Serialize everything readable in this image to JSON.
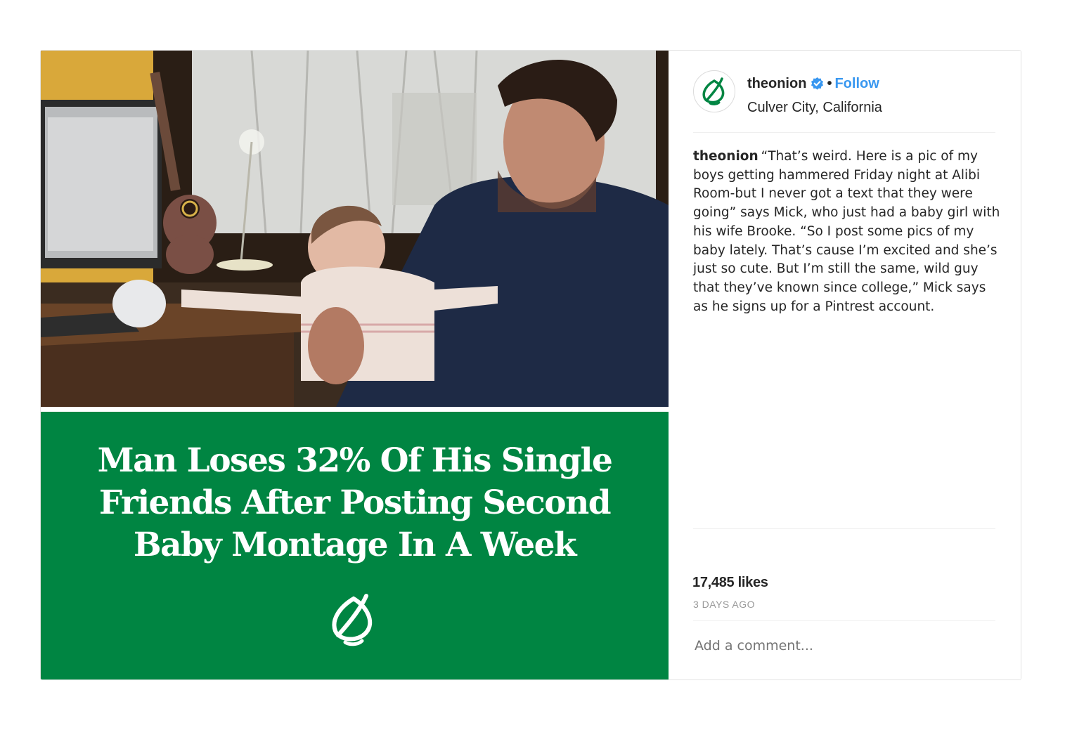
{
  "post": {
    "photo_alt": "",
    "headline": "Man Loses 32% Of His Single Friends After Posting Second Baby Montage In A Week",
    "headline_lines": [
      "Man Loses 32% Of His Single",
      "Friends After Posting Second",
      "Baby Montage In A Week"
    ]
  },
  "header": {
    "username": "theonion",
    "verified_icon": "verified-badge-icon",
    "separator": "•",
    "follow_label": "Follow",
    "location": "Culver City, California"
  },
  "caption": {
    "username": "theonion",
    "text": "“That’s weird. Here is a pic of my boys getting hammered Friday night at Alibi Room-but I never got a text that they were going” says Mick, who just had a baby girl with his wife Brooke. “So I post some pics of my baby lately. That’s cause I’m excited and she’s just so cute. But I’m still the same, wild guy that they’ve known since college,” Mick says as he signs up for a Pintrest account."
  },
  "stats": {
    "likes": "17,485 likes",
    "time_ago": "3 DAYS AGO"
  },
  "comment": {
    "placeholder": "Add a comment..."
  },
  "colors": {
    "brand_green": "#008542",
    "follow_blue": "#3897f0",
    "muted_text": "#999999"
  }
}
